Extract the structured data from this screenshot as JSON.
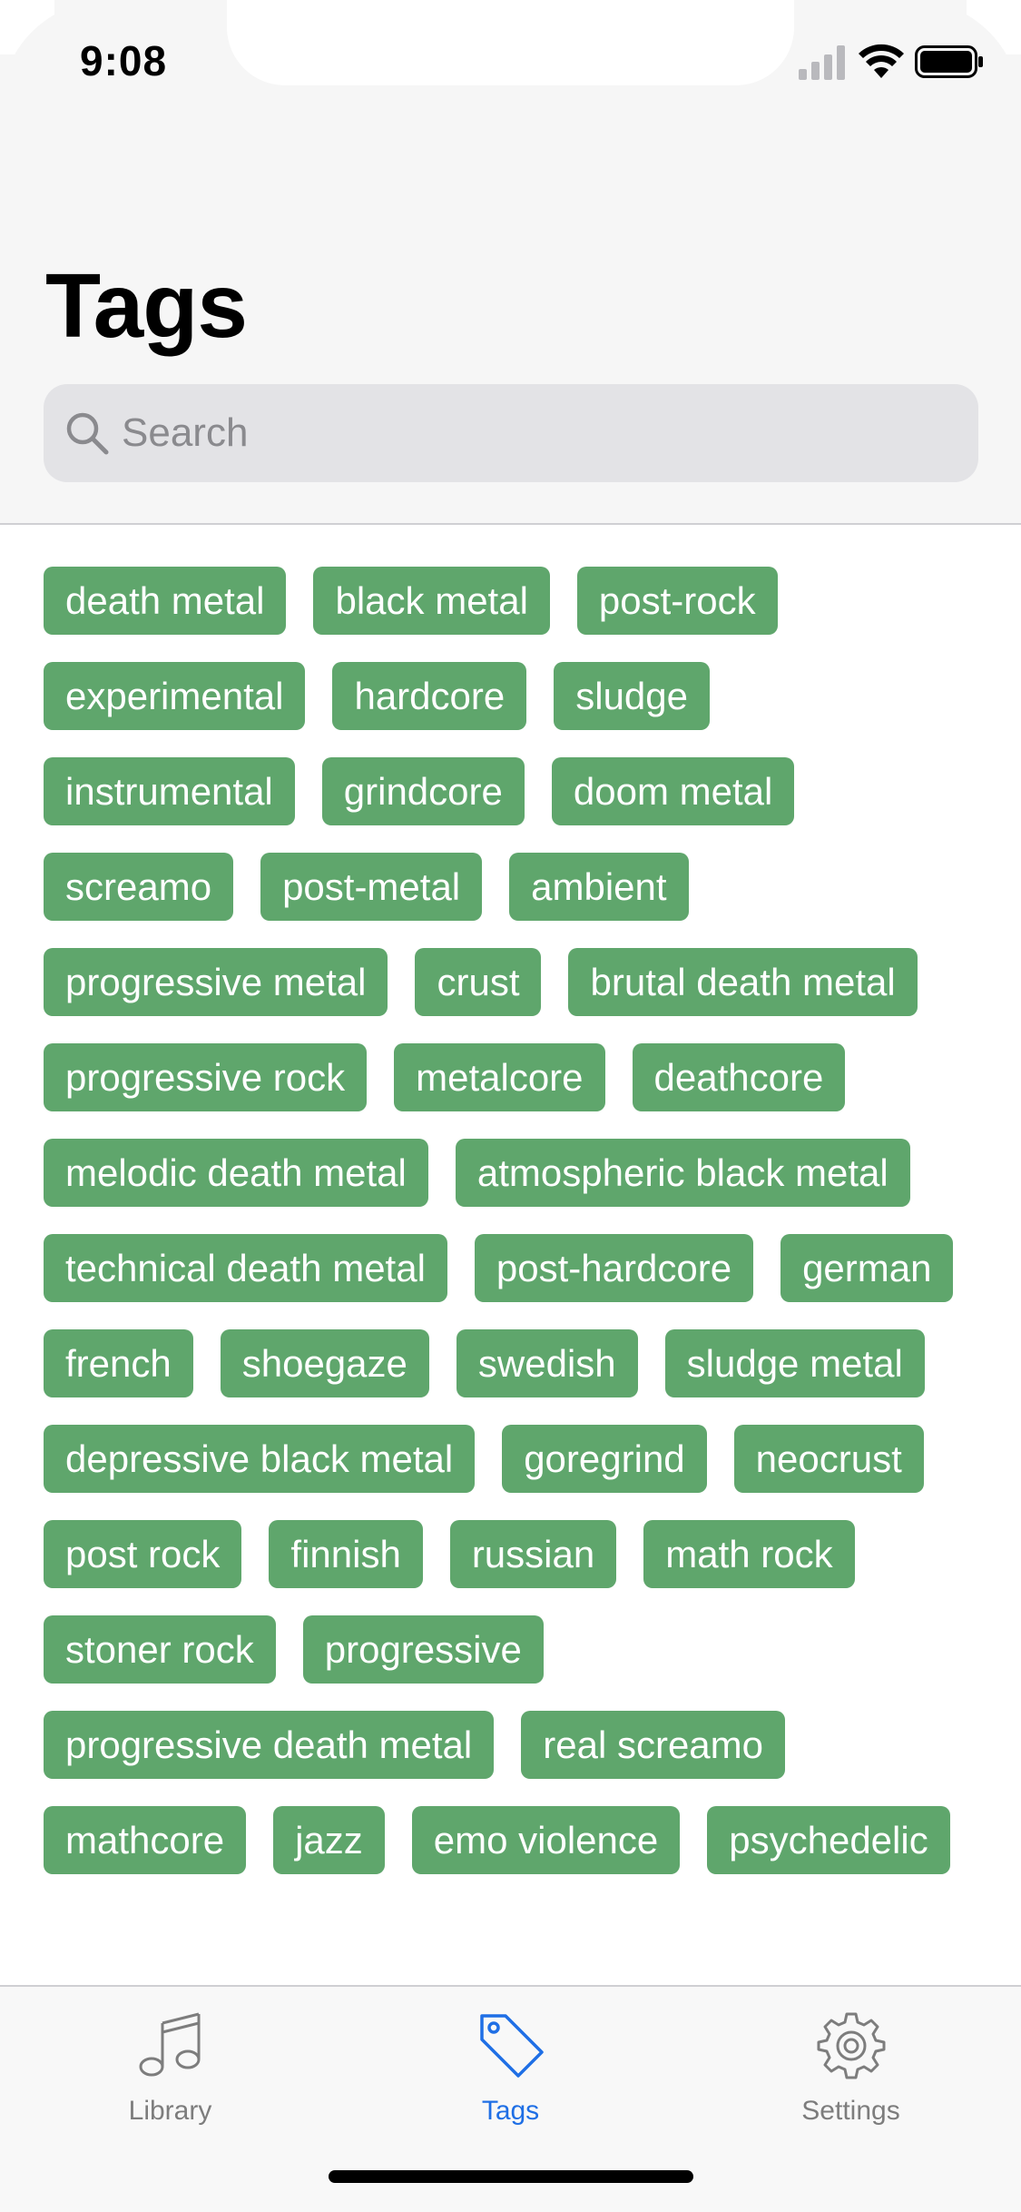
{
  "status_bar": {
    "time": "9:08"
  },
  "header": {
    "title": "Tags"
  },
  "search": {
    "placeholder": "Search",
    "value": ""
  },
  "tags": [
    "death metal",
    "black metal",
    "post-rock",
    "experimental",
    "hardcore",
    "sludge",
    "instrumental",
    "grindcore",
    "doom metal",
    "screamo",
    "post-metal",
    "ambient",
    "progressive metal",
    "crust",
    "brutal death metal",
    "progressive rock",
    "metalcore",
    "deathcore",
    "melodic death metal",
    "atmospheric black metal",
    "technical death metal",
    "post-hardcore",
    "german",
    "french",
    "shoegaze",
    "swedish",
    "sludge metal",
    "depressive black metal",
    "goregrind",
    "neocrust",
    "post rock",
    "finnish",
    "russian",
    "math rock",
    "stoner rock",
    "progressive",
    "progressive death metal",
    "real screamo",
    "mathcore",
    "jazz",
    "emo violence",
    "psychedelic"
  ],
  "tab_bar": {
    "items": [
      {
        "label": "Library",
        "icon": "music-note-icon",
        "active": false
      },
      {
        "label": "Tags",
        "icon": "tag-icon",
        "active": true
      },
      {
        "label": "Settings",
        "icon": "gear-icon",
        "active": false
      }
    ]
  },
  "colors": {
    "tag_background": "#5fa66c",
    "tag_text": "#ffffff",
    "active_tab": "#1f6fe5",
    "inactive_tab": "#7d7d7d"
  }
}
